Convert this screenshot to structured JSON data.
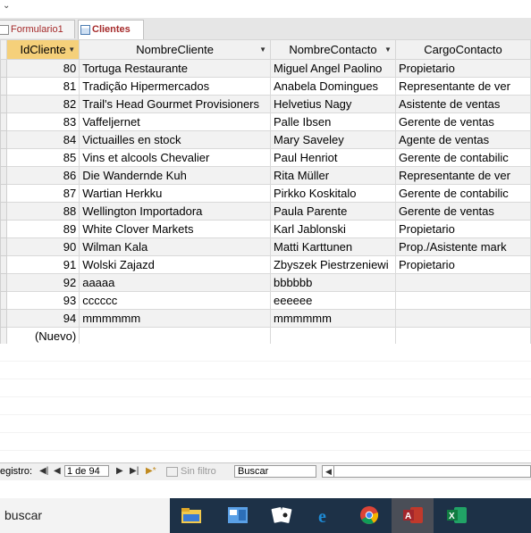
{
  "tabs": [
    {
      "label": "Formulario1",
      "active": false
    },
    {
      "label": "Clientes",
      "active": true
    }
  ],
  "grid": {
    "columns": [
      {
        "label": "IdCliente",
        "sort": "dropdown"
      },
      {
        "label": "NombreCliente",
        "sort": "dropdown"
      },
      {
        "label": "NombreContacto",
        "sort": "dropdown"
      },
      {
        "label": "CargoContacto",
        "sort": ""
      }
    ],
    "rows": [
      {
        "id": "80",
        "cliente": "Tortuga Restaurante",
        "contacto": "Miguel Angel Paolino",
        "cargo": "Propietario"
      },
      {
        "id": "81",
        "cliente": "Tradição Hipermercados",
        "contacto": "Anabela Domingues",
        "cargo": "Representante de ver"
      },
      {
        "id": "82",
        "cliente": "Trail's Head Gourmet Provisioners",
        "contacto": "Helvetius Nagy",
        "cargo": "Asistente de ventas"
      },
      {
        "id": "83",
        "cliente": "Vaffeljernet",
        "contacto": "Palle Ibsen",
        "cargo": "Gerente de ventas"
      },
      {
        "id": "84",
        "cliente": "Victuailles en stock",
        "contacto": "Mary Saveley",
        "cargo": "Agente de ventas"
      },
      {
        "id": "85",
        "cliente": "Vins et alcools Chevalier",
        "contacto": "Paul Henriot",
        "cargo": "Gerente de contabilic"
      },
      {
        "id": "86",
        "cliente": "Die Wandernde Kuh",
        "contacto": "Rita Müller",
        "cargo": "Representante de ver"
      },
      {
        "id": "87",
        "cliente": "Wartian Herkku",
        "contacto": "Pirkko Koskitalo",
        "cargo": "Gerente de contabilic"
      },
      {
        "id": "88",
        "cliente": "Wellington Importadora",
        "contacto": "Paula Parente",
        "cargo": "Gerente de ventas"
      },
      {
        "id": "89",
        "cliente": "White Clover Markets",
        "contacto": "Karl Jablonski",
        "cargo": "Propietario"
      },
      {
        "id": "90",
        "cliente": "Wilman Kala",
        "contacto": "Matti Karttunen",
        "cargo": "Prop./Asistente mark"
      },
      {
        "id": "91",
        "cliente": "Wolski  Zajazd",
        "contacto": "Zbyszek Piestrzeniewi",
        "cargo": "Propietario"
      },
      {
        "id": "92",
        "cliente": "aaaaa",
        "contacto": "bbbbbb",
        "cargo": ""
      },
      {
        "id": "93",
        "cliente": "cccccc",
        "contacto": "eeeeee",
        "cargo": ""
      },
      {
        "id": "94",
        "cliente": "mmmmmm",
        "contacto": "mmmmmm",
        "cargo": ""
      },
      {
        "id": "(Nuevo)",
        "cliente": "",
        "contacto": "",
        "cargo": ""
      }
    ]
  },
  "navigation": {
    "record_label": "egistro:",
    "record_value": "1 de 94",
    "filter_label": "Sin filtro",
    "search_value": "Buscar"
  },
  "taskbar": {
    "search_text": "buscar",
    "apps": [
      "file-explorer",
      "control-panel",
      "solitaire",
      "internet-explorer",
      "chrome",
      "access",
      "excel"
    ]
  }
}
